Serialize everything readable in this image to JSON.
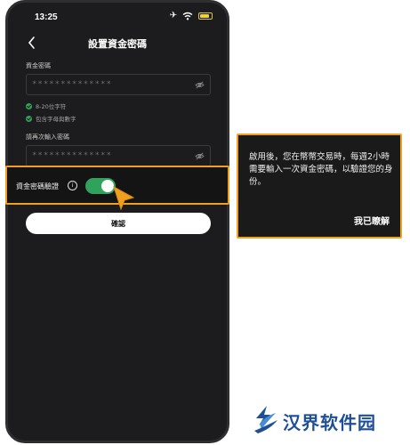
{
  "status_bar": {
    "time": "13:25"
  },
  "header": {
    "title": "設置資金密碼"
  },
  "password": {
    "label": "資金密碼",
    "placeholder": "**************"
  },
  "rules": [
    {
      "text": "8-20位字符"
    },
    {
      "text": "包含字母與數字"
    }
  ],
  "confirm_password": {
    "label": "請再次輸入密碼",
    "placeholder": "**************"
  },
  "verification_toggle": {
    "label": "資金密碼驗證",
    "state": "on"
  },
  "confirm_button": {
    "label": "確認"
  },
  "tooltip": {
    "text": "啟用後，您在幣幣交易時，每週2小時需要輸入一次資金密碼，以驗證您的身份。",
    "ack_label": "我已瞭解"
  },
  "watermark": {
    "text": "汉界软件园"
  },
  "colors": {
    "accent_orange": "#f0a01e",
    "toggle_green": "#2fa35b",
    "phone_bg": "#1c1c1e",
    "watermark_blue": "#1f4f96"
  }
}
